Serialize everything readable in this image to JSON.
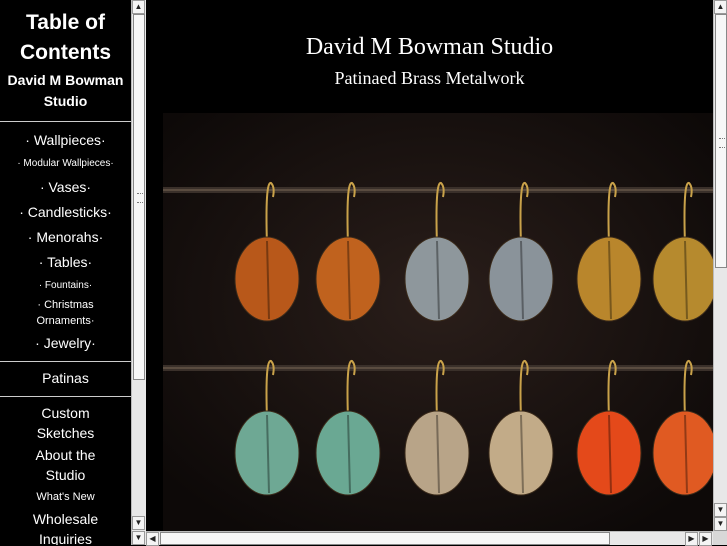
{
  "left_frame": {
    "toc_title": "Table of Contents",
    "studio_name": "David M Bowman Studio",
    "products": [
      {
        "label": "· Wallpieces·"
      },
      {
        "label": "· Modular Wallpieces·"
      },
      {
        "label": "· Vases·"
      },
      {
        "label": "· Candlesticks·"
      },
      {
        "label": "· Menorahs·"
      },
      {
        "label": "· Tables·"
      },
      {
        "label": "· Fountains·"
      },
      {
        "label": "· Christmas Ornaments·"
      },
      {
        "label": "· Jewelry·"
      }
    ],
    "patinas": "Patinas",
    "custom_sketches": "Custom Sketches",
    "about": "About the Studio",
    "whats_new": "What's New",
    "wholesale": "Wholesale Inquiries"
  },
  "main_frame": {
    "title": "David M Bowman Studio",
    "subtitle": "Patinaed Brass Metalwork"
  },
  "earrings": {
    "top_row": [
      "#b8581a",
      "#c0621e",
      "#8e979c",
      "#8a939a",
      "#b9862c",
      "#b68a2e"
    ],
    "bottom_row": [
      "#6ea894",
      "#6aa893",
      "#b8a488",
      "#c2ab88",
      "#e4491a",
      "#e05a22"
    ]
  }
}
